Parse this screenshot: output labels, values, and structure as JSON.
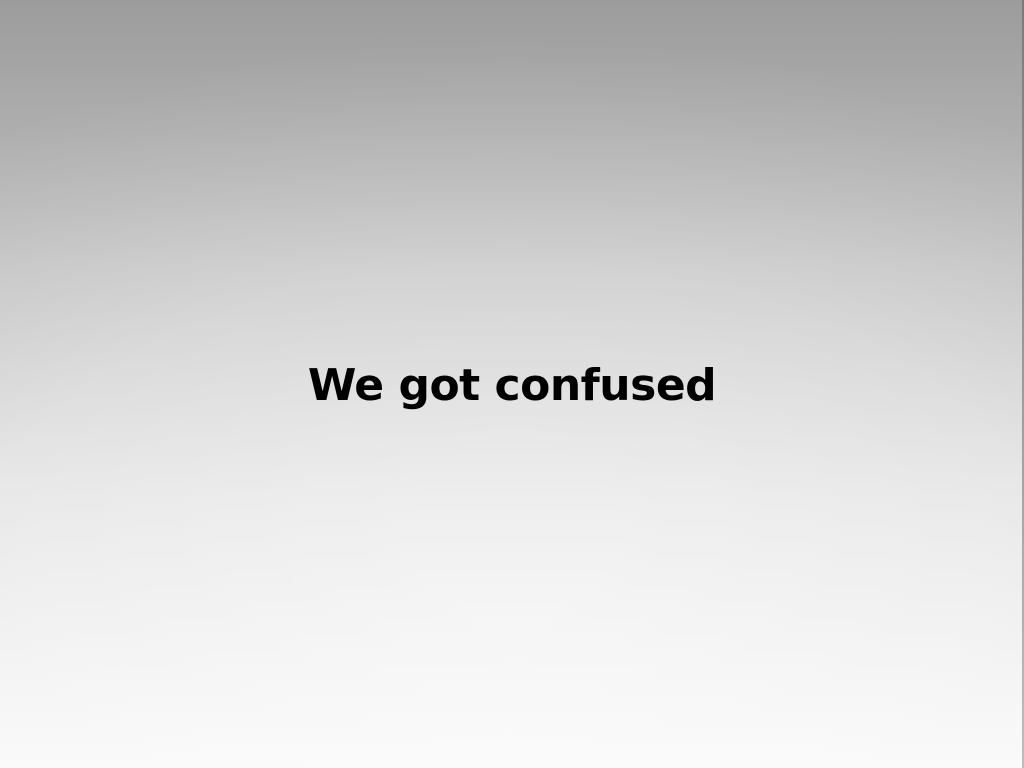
{
  "slide": {
    "title": "We got confused",
    "text_color": "#000000",
    "background_top_color": "#a9a9a9",
    "background_bottom_color": "#fafafa"
  }
}
